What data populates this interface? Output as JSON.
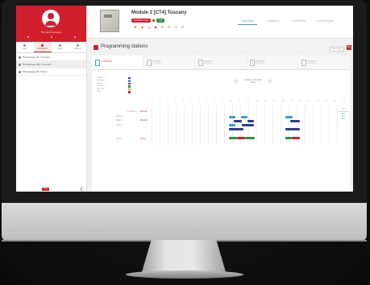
{
  "sidebar": {
    "company": "The Grid Company",
    "tabs": [
      {
        "label": "Map"
      },
      {
        "label": "Dashboard"
      },
      {
        "label": "Users"
      },
      {
        "label": "Settings"
      }
    ],
    "items": [
      {
        "label": "IM Gateway 36 / Tuscany"
      },
      {
        "label": "IM Gateway 36P / Tuscany"
      },
      {
        "label": "IM Gateway 36 / Rome"
      }
    ],
    "logo_text": "FIMO"
  },
  "header": {
    "title": "Module 2 [CT4] Tuscany",
    "status_badge": "Automatic mode",
    "online_badge": "ON",
    "tabs": [
      "OVERVIEW",
      "SCHEDULE",
      "STATISTICS",
      "NOTIFICATIONS"
    ],
    "active_tab": 0
  },
  "section": {
    "title": "Programming stations",
    "button_label": "Save changes"
  },
  "stations": [
    {
      "label": "I - STATION",
      "sub": "",
      "active": true
    },
    {
      "label": "STATION",
      "sub": "No program",
      "active": false
    },
    {
      "label": "STATION",
      "sub": "No program",
      "active": false
    },
    {
      "label": "STATION",
      "sub": "No program",
      "active": false
    },
    {
      "label": "STATION",
      "sub": "No program",
      "active": false
    }
  ],
  "legend": [
    {
      "label": "Irrigation",
      "color": "#2f3d8f"
    },
    {
      "label": "Fertilization",
      "color": "#3a9bd0"
    },
    {
      "label": "Cooling",
      "color": "#c81d6b"
    },
    {
      "label": "Flushing",
      "color": "#2d8f3f"
    },
    {
      "label": "Filter clean",
      "color": "#e8a020"
    },
    {
      "label": "Other",
      "color": "#d11f2d"
    }
  ],
  "date": {
    "label": "February 18, 2020",
    "sub": "Today"
  },
  "hours": [
    "0",
    "1",
    "2",
    "3",
    "4",
    "5",
    "6",
    "7",
    "8",
    "9",
    "10",
    "11",
    "12",
    "13",
    "14",
    "15",
    "16",
    "17",
    "18",
    "19",
    "20",
    "21",
    "22",
    "23"
  ],
  "rows": [
    {
      "label": "Program A",
      "red_label": "Manual"
    },
    {
      "label": "Valve 1",
      "red_label": "Manual"
    },
    {
      "label": "Valve 2",
      "red_label": ""
    },
    {
      "label": "Valve 3",
      "red_label": ""
    },
    {
      "label": "Pump",
      "red_label": "Active"
    }
  ],
  "right_col": [
    "Time",
    "Consumption",
    "No.1",
    "No.2",
    "No.3"
  ]
}
